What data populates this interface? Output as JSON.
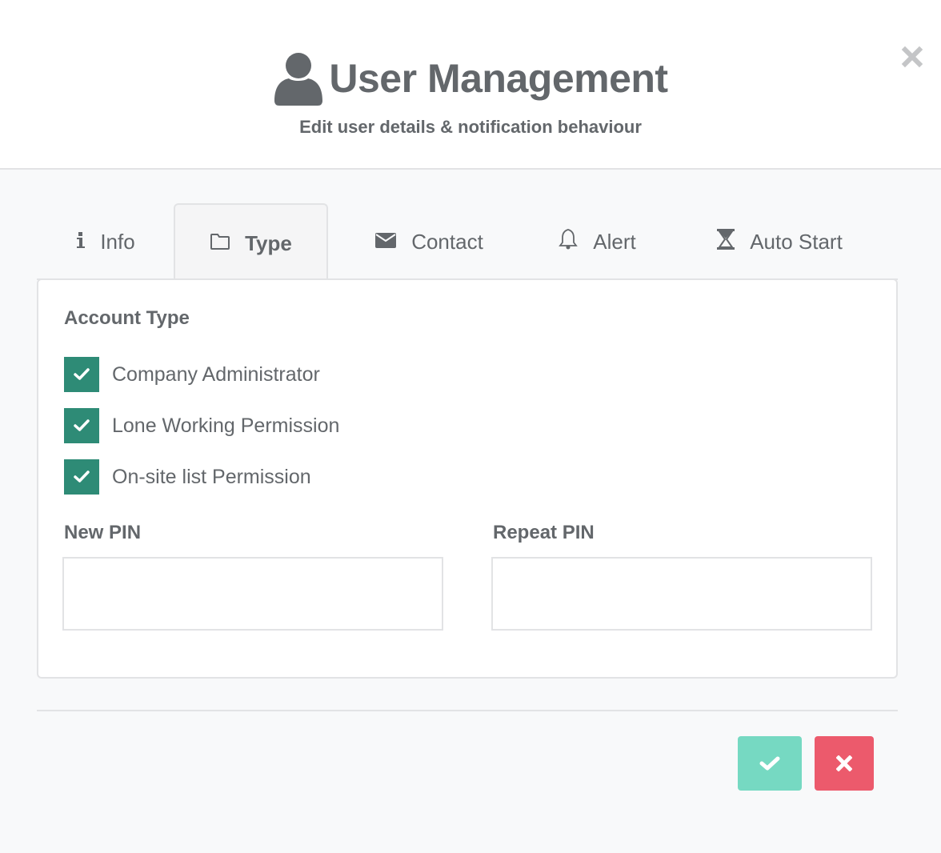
{
  "header": {
    "title": "User Management",
    "subtitle": "Edit user details & notification behaviour",
    "title_icon": "user-icon",
    "close_icon": "close-icon"
  },
  "tabs": [
    {
      "label": "Info",
      "icon": "info-icon",
      "active": false
    },
    {
      "label": "Type",
      "icon": "folder-icon",
      "active": true
    },
    {
      "label": "Contact",
      "icon": "envelope-icon",
      "active": false
    },
    {
      "label": "Alert",
      "icon": "bell-icon",
      "active": false
    },
    {
      "label": "Auto Start",
      "icon": "hourglass-icon",
      "active": false
    }
  ],
  "panel": {
    "section_title": "Account Type",
    "checkboxes": [
      {
        "label": "Company Administrator",
        "checked": true
      },
      {
        "label": "Lone Working Permission",
        "checked": true
      },
      {
        "label": "On-site list Permission",
        "checked": true
      }
    ],
    "new_pin": {
      "label": "New PIN",
      "value": "",
      "placeholder": ""
    },
    "repeat_pin": {
      "label": "Repeat PIN",
      "value": "",
      "placeholder": ""
    }
  },
  "footer": {
    "confirm_icon": "check-icon",
    "cancel_icon": "close-icon"
  },
  "colors": {
    "text": "#63676b",
    "checkbox": "#2e8b76",
    "confirm": "#76d9c2",
    "cancel": "#ec5a6c",
    "border": "#e2e3e5",
    "background": "#f8f9fa"
  }
}
